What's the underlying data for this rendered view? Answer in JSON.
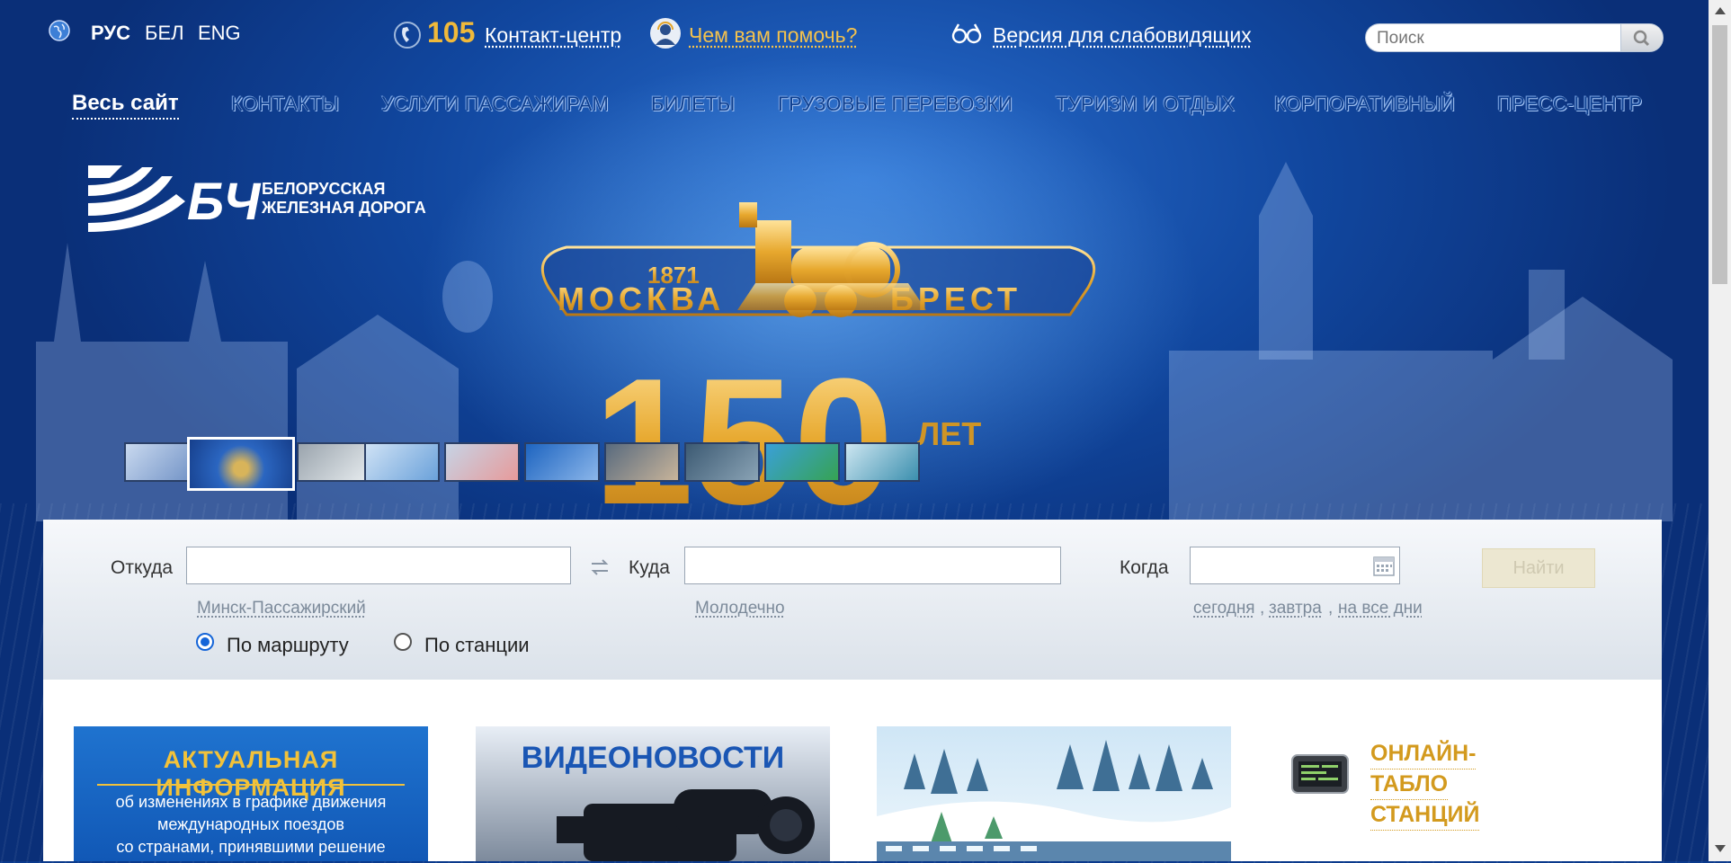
{
  "top_bar": {
    "languages": [
      {
        "label": "РУС",
        "active": true
      },
      {
        "label": "БЕЛ",
        "active": false
      },
      {
        "label": "ENG",
        "active": false
      }
    ],
    "phone_number": "105",
    "contact_center_label": "Контакт-центр",
    "help_label": "Чем вам помочь?",
    "low_vision_label": "Версия для слабовидящих",
    "search_placeholder": "Поиск"
  },
  "nav": {
    "all_site": "Весь сайт",
    "items": [
      "КОНТАКТЫ",
      "УСЛУГИ ПАССАЖИРАМ",
      "БИЛЕТЫ",
      "ГРУЗОВЫЕ ПЕРЕВОЗКИ",
      "ТУРИЗМ И ОТДЫХ",
      "КОРПОРАТИВНЫЙ",
      "ПРЕСС-ЦЕНТР"
    ]
  },
  "logo": {
    "mark": "БЧ",
    "line1": "БЕЛОРУССКАЯ",
    "line2": "ЖЕЛЕЗНАЯ ДОРОГА"
  },
  "banner": {
    "year": "1871",
    "city_left": "МОСКВА",
    "city_right": "БРЕСТ",
    "anniversary_number": "150",
    "anniversary_unit": "ЛЕТ",
    "thumbnail_count": 10,
    "active_thumbnail": 2
  },
  "route_search": {
    "from_label": "Откуда",
    "to_label": "Куда",
    "when_label": "Когда",
    "from_value": "",
    "to_value": "",
    "date_value": "",
    "from_hint": "Минск-Пассажирский",
    "to_hint": "Молодечно",
    "date_hints": [
      "сегодня",
      "завтра",
      "на все дни"
    ],
    "date_hint_separator": ",",
    "find_button": "Найти",
    "mode_route": "По маршруту",
    "mode_station": "По станции",
    "selected_mode": "route"
  },
  "tiles": {
    "actual_info_title": "АКТУАЛЬНАЯ ИНФОРМАЦИЯ",
    "actual_info_lines": [
      "об изменениях в графике движения",
      "международных поездов",
      "со странами, принявшими решение"
    ],
    "video_news_title": "ВИДЕОНОВОСТИ",
    "online_board_lines": [
      "ОНЛАЙН-",
      "ТАБЛО",
      "СТАНЦИЙ"
    ]
  },
  "colors": {
    "gold": "#f0b93a",
    "brand_blue": "#1158b6",
    "link_gold": "#d39a1e"
  }
}
